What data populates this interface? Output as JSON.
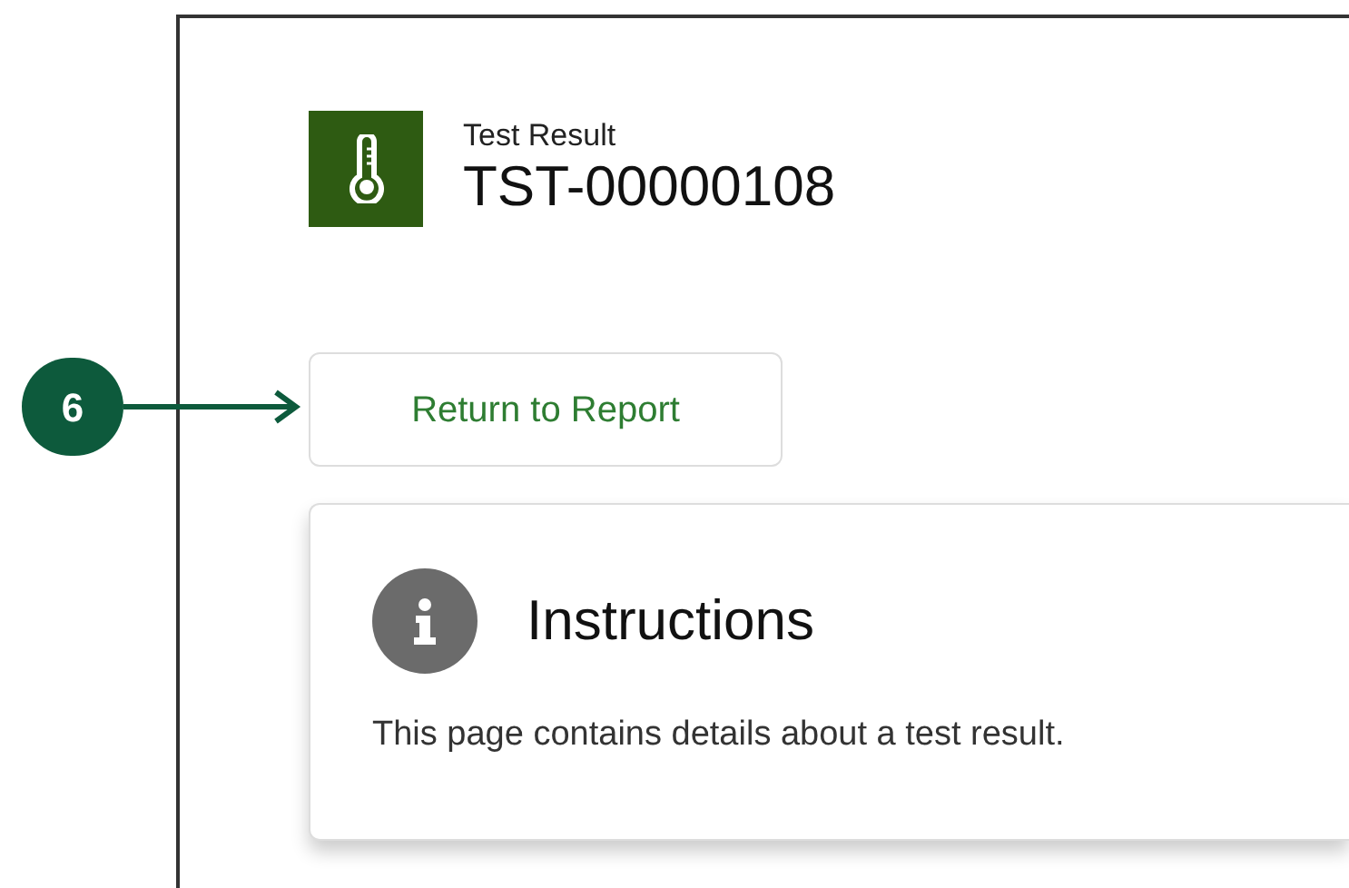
{
  "header": {
    "object_type": "Test Result",
    "record_id": "TST-00000108"
  },
  "return_button": {
    "label": "Return to Report"
  },
  "instructions_card": {
    "title": "Instructions",
    "body": "This page contains details about a test result."
  },
  "callout": {
    "number": "6"
  }
}
